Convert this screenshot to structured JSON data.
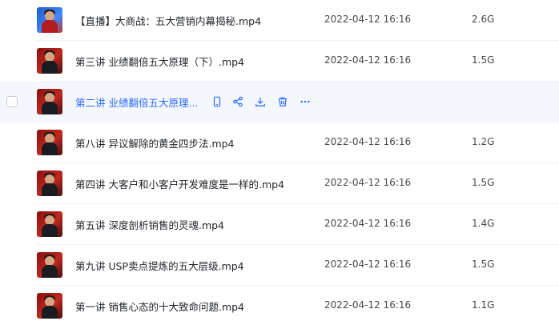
{
  "colors": {
    "accent": "#2f6bff",
    "hover_bg": "#f4f7fe",
    "text": "#1f2329",
    "meta": "#45484d"
  },
  "actions": [
    "phone-icon",
    "share-icon",
    "download-icon",
    "delete-icon",
    "more-icon"
  ],
  "files": [
    {
      "name": "【直播】大商战：五大营销内幕揭秘.mp4",
      "time": "2022-04-12 16:16",
      "size": "2.6G",
      "thumb": "blue"
    },
    {
      "name": "第三讲 业绩翻倍五大原理（下）.mp4",
      "time": "2022-04-12 16:16",
      "size": "1.5G",
      "thumb": "red"
    },
    {
      "name": "第二讲 业绩翻倍五大原理...",
      "time": "",
      "size": "",
      "thumb": "red",
      "hovered": true
    },
    {
      "name": "第八讲 异议解除的黄金四步法.mp4",
      "time": "2022-04-12 16:16",
      "size": "1.2G",
      "thumb": "red"
    },
    {
      "name": "第四讲 大客户和小客户开发难度是一样的.mp4",
      "time": "2022-04-12 16:16",
      "size": "1.5G",
      "thumb": "red"
    },
    {
      "name": "第五讲 深度剖析销售的灵魂.mp4",
      "time": "2022-04-12 16:16",
      "size": "1.4G",
      "thumb": "red"
    },
    {
      "name": "第九讲 USP卖点提炼的五大层级.mp4",
      "time": "2022-04-12 16:16",
      "size": "1.5G",
      "thumb": "red"
    },
    {
      "name": "第一讲 销售心态的十大致命问题.mp4",
      "time": "2022-04-12 16:16",
      "size": "1.1G",
      "thumb": "red"
    }
  ]
}
